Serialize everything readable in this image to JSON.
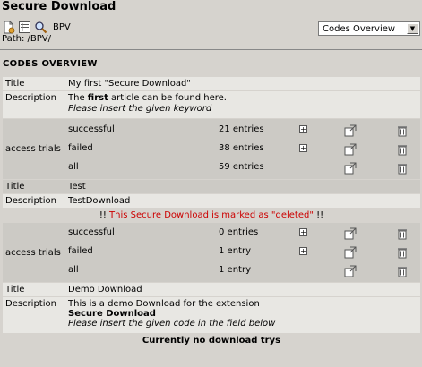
{
  "header": {
    "title": "Secure Download",
    "bpv_label": "BPV",
    "path": "Path: /BPV/"
  },
  "select": {
    "value": "Codes Overview"
  },
  "section_title": "CODES OVERVIEW",
  "labels": {
    "title": "Title",
    "description": "Description",
    "access_trials": "access trials",
    "successful": "successful",
    "failed": "failed",
    "all": "all"
  },
  "records": [
    {
      "title": "My first \"Secure Download\"",
      "desc_pre": "The ",
      "desc_bold": "first",
      "desc_post": " article can be found here.",
      "desc_italic": "Please insert the given keyword",
      "successful": "21 entries",
      "failed": "38 entries",
      "all": "59 entries"
    },
    {
      "title": "Test",
      "description": "TestDownload",
      "deleted_bang_left": "!!",
      "deleted_msg": "This Secure Download is marked as \"deleted\"",
      "deleted_bang_right": "!!",
      "successful": "0 entries",
      "failed": "1 entry",
      "all": "1 entry"
    },
    {
      "title": "Demo Download",
      "desc_line1": "This is a demo Download for the extension",
      "desc_bold": "Secure Download",
      "desc_italic": "Please insert the given code in the field below"
    }
  ],
  "footer": "Currently no download trys",
  "icons": [
    "new-document-icon",
    "list-icon",
    "search-icon",
    "plus-icon",
    "open-external-icon",
    "trash-icon"
  ]
}
